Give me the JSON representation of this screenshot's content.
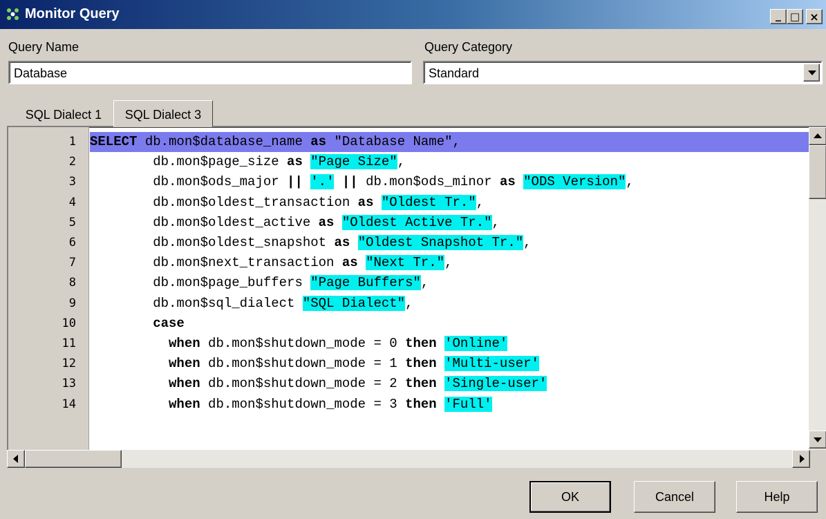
{
  "window": {
    "title": "Monitor Query",
    "icon": "monitor-query-icon",
    "controls": {
      "minimize": "_",
      "maximize": "□",
      "close": "×"
    }
  },
  "form": {
    "query_name_label": "Query Name",
    "query_name_value": "Database",
    "query_category_label": "Query Category",
    "query_category_value": "Standard"
  },
  "tabs": [
    {
      "label": "SQL Dialect 1",
      "active": false
    },
    {
      "label": "SQL Dialect 3",
      "active": true
    }
  ],
  "editor": {
    "line_numbers": [
      "1",
      "2",
      "3",
      "4",
      "5",
      "6",
      "7",
      "8",
      "9",
      "10",
      "11",
      "12",
      "13",
      "14"
    ],
    "lines": [
      {
        "selected": true,
        "segments": [
          {
            "t": "SELECT",
            "k": "kw"
          },
          {
            "t": " db.mon$database_name ",
            "k": ""
          },
          {
            "t": "as",
            "k": "kw"
          },
          {
            "t": " \"Database Name\",",
            "k": ""
          }
        ]
      },
      {
        "segments": [
          {
            "t": "        db.mon$page_size ",
            "k": ""
          },
          {
            "t": "as",
            "k": "kw"
          },
          {
            "t": " ",
            "k": ""
          },
          {
            "t": "\"Page Size\"",
            "k": "str"
          },
          {
            "t": ",",
            "k": ""
          }
        ]
      },
      {
        "segments": [
          {
            "t": "        db.mon$ods_major ",
            "k": ""
          },
          {
            "t": "||",
            "k": "kw"
          },
          {
            "t": " ",
            "k": ""
          },
          {
            "t": "'.'",
            "k": "str"
          },
          {
            "t": " ",
            "k": ""
          },
          {
            "t": "||",
            "k": "kw"
          },
          {
            "t": " db.mon$ods_minor ",
            "k": ""
          },
          {
            "t": "as",
            "k": "kw"
          },
          {
            "t": " ",
            "k": ""
          },
          {
            "t": "\"ODS Version\"",
            "k": "str"
          },
          {
            "t": ",",
            "k": ""
          }
        ]
      },
      {
        "segments": [
          {
            "t": "        db.mon$oldest_transaction ",
            "k": ""
          },
          {
            "t": "as",
            "k": "kw"
          },
          {
            "t": " ",
            "k": ""
          },
          {
            "t": "\"Oldest Tr.\"",
            "k": "str"
          },
          {
            "t": ",",
            "k": ""
          }
        ]
      },
      {
        "segments": [
          {
            "t": "        db.mon$oldest_active ",
            "k": ""
          },
          {
            "t": "as",
            "k": "kw"
          },
          {
            "t": " ",
            "k": ""
          },
          {
            "t": "\"Oldest Active Tr.\"",
            "k": "str"
          },
          {
            "t": ",",
            "k": ""
          }
        ]
      },
      {
        "segments": [
          {
            "t": "        db.mon$oldest_snapshot ",
            "k": ""
          },
          {
            "t": "as",
            "k": "kw"
          },
          {
            "t": " ",
            "k": ""
          },
          {
            "t": "\"Oldest Snapshot Tr.\"",
            "k": "str"
          },
          {
            "t": ",",
            "k": ""
          }
        ]
      },
      {
        "segments": [
          {
            "t": "        db.mon$next_transaction ",
            "k": ""
          },
          {
            "t": "as",
            "k": "kw"
          },
          {
            "t": " ",
            "k": ""
          },
          {
            "t": "\"Next Tr.\"",
            "k": "str"
          },
          {
            "t": ",",
            "k": ""
          }
        ]
      },
      {
        "segments": [
          {
            "t": "        db.mon$page_buffers ",
            "k": ""
          },
          {
            "t": "\"Page Buffers\"",
            "k": "str"
          },
          {
            "t": ",",
            "k": ""
          }
        ]
      },
      {
        "segments": [
          {
            "t": "        db.mon$sql_dialect ",
            "k": ""
          },
          {
            "t": "\"SQL Dialect\"",
            "k": "str"
          },
          {
            "t": ",",
            "k": ""
          }
        ]
      },
      {
        "segments": [
          {
            "t": "        ",
            "k": ""
          },
          {
            "t": "case",
            "k": "kw"
          }
        ]
      },
      {
        "segments": [
          {
            "t": "          ",
            "k": ""
          },
          {
            "t": "when",
            "k": "kw"
          },
          {
            "t": " db.mon$shutdown_mode = 0 ",
            "k": ""
          },
          {
            "t": "then",
            "k": "kw"
          },
          {
            "t": " ",
            "k": ""
          },
          {
            "t": "'Online'",
            "k": "str"
          }
        ]
      },
      {
        "segments": [
          {
            "t": "          ",
            "k": ""
          },
          {
            "t": "when",
            "k": "kw"
          },
          {
            "t": " db.mon$shutdown_mode = 1 ",
            "k": ""
          },
          {
            "t": "then",
            "k": "kw"
          },
          {
            "t": " ",
            "k": ""
          },
          {
            "t": "'Multi-user'",
            "k": "str"
          }
        ]
      },
      {
        "segments": [
          {
            "t": "          ",
            "k": ""
          },
          {
            "t": "when",
            "k": "kw"
          },
          {
            "t": " db.mon$shutdown_mode = 2 ",
            "k": ""
          },
          {
            "t": "then",
            "k": "kw"
          },
          {
            "t": " ",
            "k": ""
          },
          {
            "t": "'Single-user'",
            "k": "str"
          }
        ]
      },
      {
        "segments": [
          {
            "t": "          ",
            "k": ""
          },
          {
            "t": "when",
            "k": "kw"
          },
          {
            "t": " db.mon$shutdown_mode = 3 ",
            "k": ""
          },
          {
            "t": "then",
            "k": "kw"
          },
          {
            "t": " ",
            "k": ""
          },
          {
            "t": "'Full'",
            "k": "str"
          }
        ]
      }
    ]
  },
  "buttons": {
    "ok": "OK",
    "cancel": "Cancel",
    "help": "Help"
  },
  "colors": {
    "title_gradient_start": "#0a246a",
    "selection": "#7b7bee",
    "string_highlight": "#00f0f0",
    "dialog_face": "#d4d0c8"
  }
}
